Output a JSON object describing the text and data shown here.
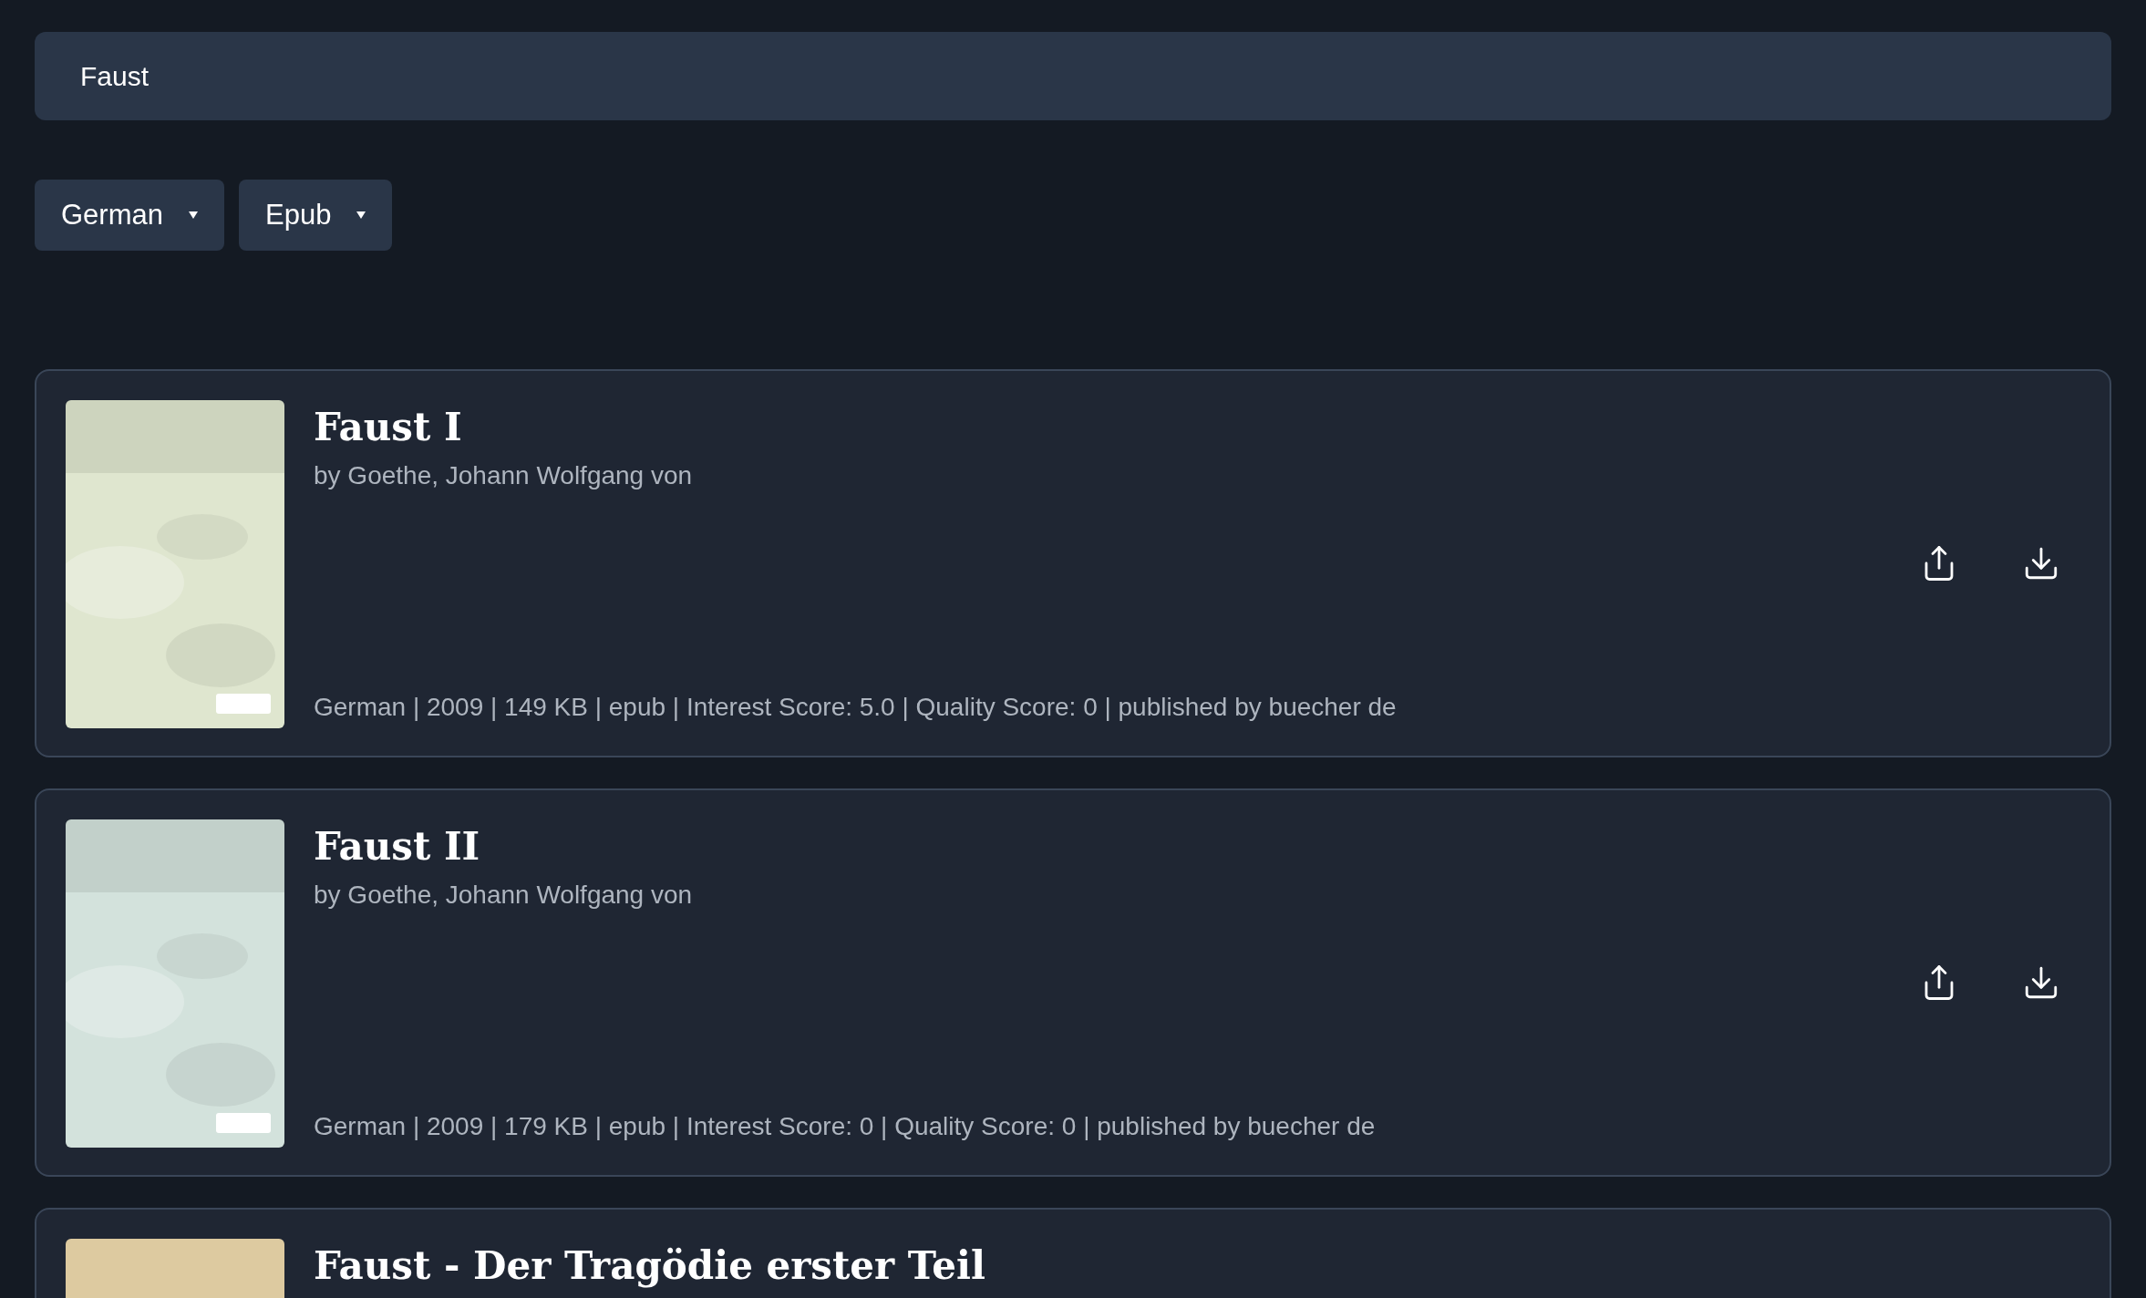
{
  "search": {
    "value": "Faust"
  },
  "filters": [
    {
      "label": "German"
    },
    {
      "label": "Epub"
    }
  ],
  "results": [
    {
      "title": "Faust I",
      "author": "by Goethe, Johann Wolfgang von",
      "meta": "German | 2009 | 149 KB | epub | Interest Score: 5.0 | Quality Score: 0 | published by buecher de"
    },
    {
      "title": "Faust II",
      "author": "by Goethe, Johann Wolfgang von",
      "meta": "German | 2009 | 179 KB | epub | Interest Score: 0 | Quality Score: 0 | published by buecher de"
    },
    {
      "title": "Faust - Der Tragödie erster Teil"
    }
  ]
}
